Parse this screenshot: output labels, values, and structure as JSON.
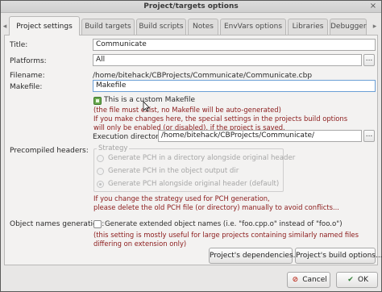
{
  "window": {
    "title": "Project/targets options",
    "close_glyph": "×"
  },
  "tabs": [
    {
      "label": "Project settings",
      "active": true
    },
    {
      "label": "Build targets"
    },
    {
      "label": "Build scripts"
    },
    {
      "label": "Notes"
    },
    {
      "label": "EnvVars options"
    },
    {
      "label": "Libraries"
    },
    {
      "label": "Debugger"
    }
  ],
  "tab_scroll": {
    "left": "◂",
    "right": "▸"
  },
  "form": {
    "title_label": "Title:",
    "title_value": "Communicate",
    "platforms_label": "Platforms:",
    "platforms_value": "All",
    "filename_label": "Filename:",
    "filename_value": "/home/bitehack/CBProjects/Communicate/Communicate.cbp",
    "makefile_label": "Makefile:",
    "makefile_value": "Makefile",
    "custom_makefile_label": "This is a custom Makefile",
    "custom_makefile_checked": true,
    "custom_note_1": "(the file must exist, no Makefile will be auto-generated)",
    "custom_note_2": "If you make changes here, the special settings in the projects build options",
    "custom_note_3": "will only be enabled (or disabled), if the project is saved.",
    "exec_dir_label": "Execution directory:",
    "exec_dir_value": "/home/bitehack/CBProjects/Communicate/",
    "browse_glyph": "...",
    "pch_label": "Precompiled headers:",
    "strategy_title": "Strategy",
    "pch_options": [
      "Generate PCH in a directory alongside original header",
      "Generate PCH in the object output dir",
      "Generate PCH alongside original header (default)"
    ],
    "pch_selected_index": 2,
    "pch_note_1": "If you change the strategy used for PCH generation,",
    "pch_note_2": "please delete the old PCH file (or directory) manually to avoid conflicts...",
    "objnames_label": "Object names generation:",
    "objnames_check_label": "Generate extended object names (i.e. \"foo.cpp.o\" instead of \"foo.o\")",
    "objnames_checked": false,
    "objnames_note_1": "(this setting is mostly useful for large projects containing similarly named files",
    "objnames_note_2": "differing on extension only)"
  },
  "buttons": {
    "dependencies": "Project's dependencies...",
    "build_options": "Project's build options...",
    "cancel": "Cancel",
    "cancel_icon": "cancel-icon",
    "ok": "OK",
    "ok_icon": "check-icon"
  },
  "colors": {
    "note_red": "#8b1a1a",
    "check_green": "#6aa84f"
  }
}
